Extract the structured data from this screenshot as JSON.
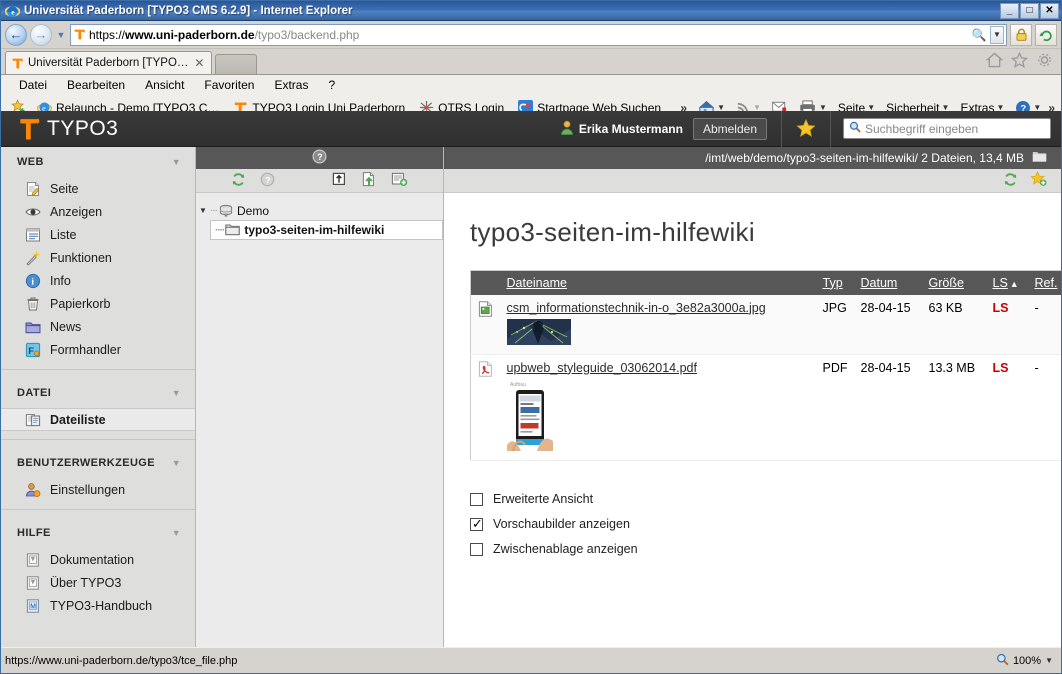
{
  "browser": {
    "title": "Universität Paderborn [TYPO3 CMS 6.2.9] - Internet Explorer",
    "window_buttons": {
      "minimize": "_",
      "maximize": "□",
      "close": "✕"
    },
    "url_secure_scheme": "https://",
    "url_host": "www.uni-paderborn.de",
    "url_path": "/typo3/backend.php",
    "tab_label": "Universität Paderborn [TYPO…",
    "tab_close": "✕",
    "menu": [
      "Datei",
      "Bearbeiten",
      "Ansicht",
      "Favoriten",
      "Extras",
      "?"
    ],
    "favorites": [
      {
        "label": "Relaunch - Demo [TYPO3 C…",
        "icon": "ie-icon"
      },
      {
        "label": "TYPO3 Login Uni Paderborn",
        "icon": "typo3-icon"
      },
      {
        "label": "OTRS  Login",
        "icon": "otrs-icon"
      },
      {
        "label": "Startpage Web Suchen",
        "icon": "startpage-icon"
      }
    ],
    "fav_overflow": "»",
    "command_bar": [
      "Seite",
      "Sicherheit",
      "Extras"
    ],
    "command_overflow": "»",
    "status_url": "https://www.uni-paderborn.de/typo3/tce_file.php",
    "zoom_level": "100%"
  },
  "typo3": {
    "logo_text": "TYPO3",
    "user_name": "Erika Mustermann",
    "logout_label": "Abmelden",
    "search_placeholder": "Suchbegriff eingeben",
    "accent_color": "#ff8700",
    "sidebar": [
      {
        "title": "WEB",
        "items": [
          {
            "label": "Seite",
            "icon": "page-icon",
            "active": false
          },
          {
            "label": "Anzeigen",
            "icon": "eye-icon",
            "active": false
          },
          {
            "label": "Liste",
            "icon": "list-icon",
            "active": false
          },
          {
            "label": "Funktionen",
            "icon": "wand-icon",
            "active": false
          },
          {
            "label": "Info",
            "icon": "info-icon",
            "active": false
          },
          {
            "label": "Papierkorb",
            "icon": "trash-icon",
            "active": false
          },
          {
            "label": "News",
            "icon": "folder-icon",
            "active": false
          },
          {
            "label": "Formhandler",
            "icon": "formhandler-icon",
            "active": false
          }
        ]
      },
      {
        "title": "DATEI",
        "items": [
          {
            "label": "Dateiliste",
            "icon": "filelist-icon",
            "active": true
          }
        ]
      },
      {
        "title": "BENUTZERWERKZEUGE",
        "items": [
          {
            "label": "Einstellungen",
            "icon": "user-settings-icon",
            "active": false
          }
        ]
      },
      {
        "title": "HILFE",
        "items": [
          {
            "label": "Dokumentation",
            "icon": "doc-icon",
            "active": false
          },
          {
            "label": "Über TYPO3",
            "icon": "doc-icon",
            "active": false
          },
          {
            "label": "TYPO3-Handbuch",
            "icon": "manual-icon",
            "active": false
          }
        ]
      }
    ],
    "tree": {
      "root_label": "Demo",
      "child_label": "typo3-seiten-im-hilfewiki",
      "collapse_toggle": "▼"
    },
    "path_info": "/imt/web/demo/typo3-seiten-im-hilfewiki/ 2 Dateien, 13,4 MB",
    "page_title": "typo3-seiten-im-hilfewiki",
    "table": {
      "headers": [
        "Dateiname",
        "Typ",
        "Datum",
        "Größe",
        "LS",
        "Ref."
      ],
      "sort_indicator": "▲",
      "sort_column": "LS",
      "rows": [
        {
          "icon": "image-file-icon",
          "name": "csm_informationstechnik-in-o_3e82a3000a.jpg",
          "typ": "JPG",
          "datum": "28-04-15",
          "groesse": "63 KB",
          "ls": "LS",
          "ref": "-",
          "thumb": "landscape-network-photo"
        },
        {
          "icon": "pdf-file-icon",
          "name": "upbweb_styleguide_03062014.pdf",
          "typ": "PDF",
          "datum": "28-04-15",
          "groesse": "13.3 MB",
          "ls": "LS",
          "ref": "-",
          "thumb": "tablet-in-hands-photo"
        }
      ]
    },
    "checkboxes": [
      {
        "label": "Erweiterte Ansicht",
        "checked": false
      },
      {
        "label": "Vorschaubilder anzeigen",
        "checked": true
      },
      {
        "label": "Zwischenablage anzeigen",
        "checked": false
      }
    ]
  }
}
